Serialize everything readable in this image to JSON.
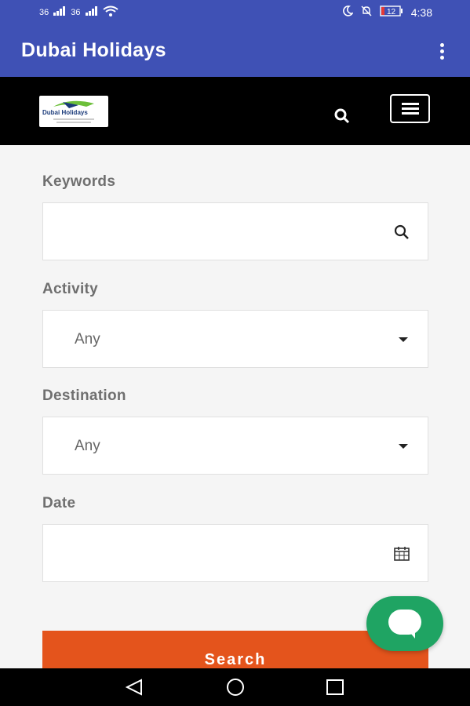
{
  "status_bar": {
    "left_indicators": [
      "36",
      "36"
    ],
    "time": "4:38",
    "battery": "12"
  },
  "app_bar": {
    "title": "Dubai Holidays",
    "overflow_icon": "more-vert-icon"
  },
  "site_header": {
    "logo_text": "Dubai Holidays",
    "search_icon": "search-icon",
    "menu_icon": "hamburger-menu-icon"
  },
  "form": {
    "keywords": {
      "label": "Keywords",
      "value": "",
      "icon": "search-icon"
    },
    "activity": {
      "label": "Activity",
      "selected": "Any",
      "icon": "dropdown-caret-icon"
    },
    "destination": {
      "label": "Destination",
      "selected": "Any",
      "icon": "dropdown-caret-icon"
    },
    "date": {
      "label": "Date",
      "value": "",
      "icon": "calendar-icon"
    },
    "submit_label": "Search"
  },
  "chat": {
    "icon": "chat-bubble-icon"
  },
  "colors": {
    "app_bar": "#3f51b5",
    "accent": "#e4541c",
    "chat": "#1fa463"
  },
  "nav_bar": {
    "buttons": [
      "back-icon",
      "home-icon",
      "recents-icon"
    ]
  }
}
